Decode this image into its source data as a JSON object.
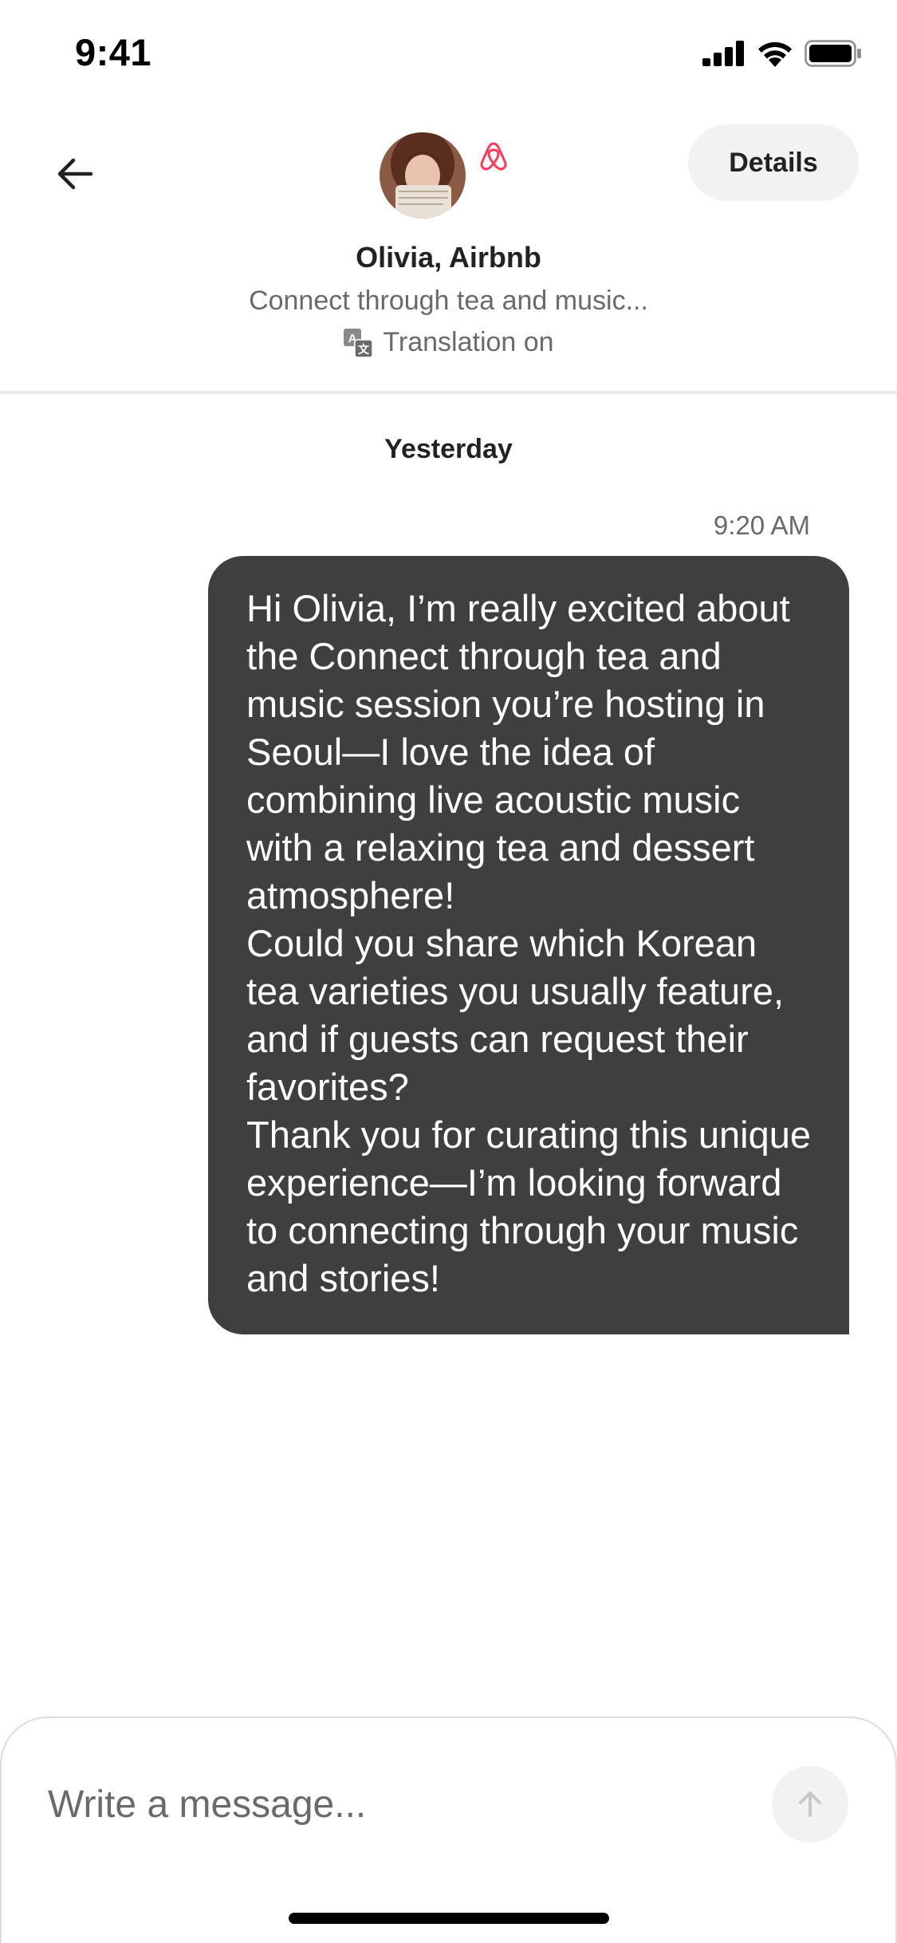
{
  "status_bar": {
    "time": "9:41"
  },
  "header": {
    "host_name": "Olivia, Airbnb",
    "subtitle": "Connect through tea and music...",
    "translation_label": "Translation on",
    "details_label": "Details",
    "back_icon": "arrow-left-icon",
    "brand_icon": "airbnb-logo-icon",
    "brand_color": "#ff385c"
  },
  "conversation": {
    "day_label": "Yesterday",
    "messages": [
      {
        "time": "9:20 AM",
        "text": "Hi Olivia, I’m really excited about the Connect through tea and music session you’re hosting in Seoul—I love the idea of combining live acoustic music with a relaxing tea and dessert atmosphere!\nCould you share which Korean tea varieties you usually feature, and if guests can request their favorites?\nThank you for curating this unique experience—I’m looking forward to connecting through your music and stories!",
        "bubble_color": "#3f3f3f"
      }
    ]
  },
  "composer": {
    "placeholder": "Write a message...",
    "send_icon": "arrow-up-icon"
  }
}
